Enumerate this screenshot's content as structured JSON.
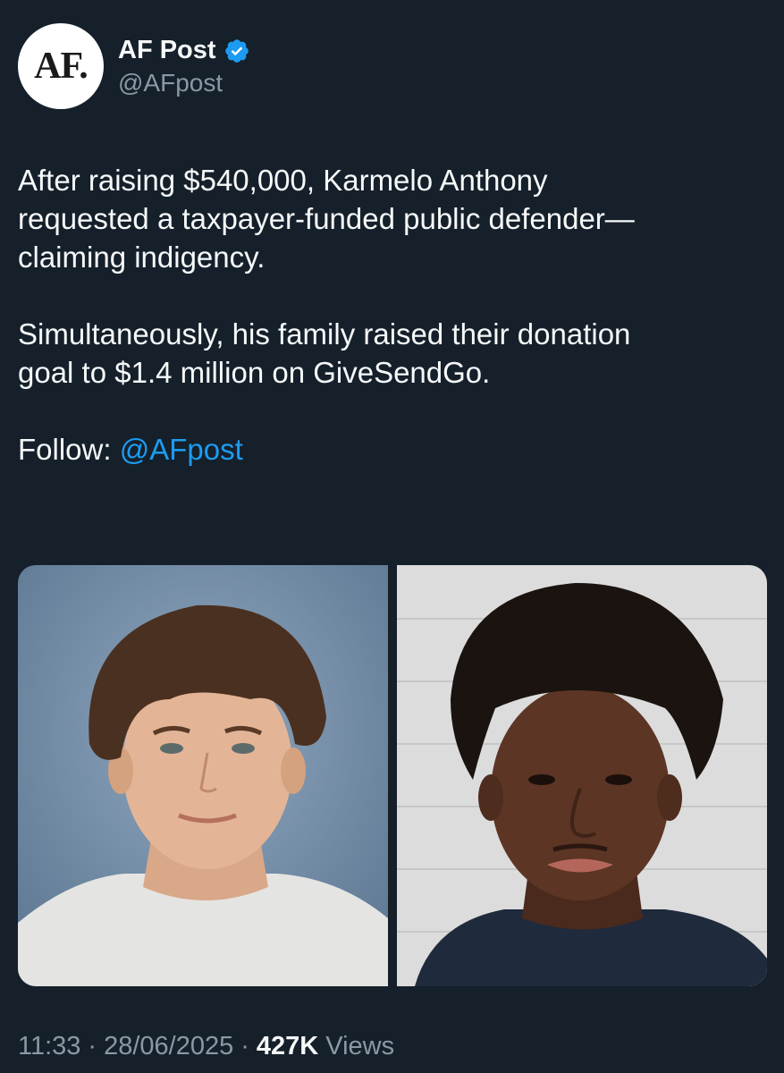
{
  "author": {
    "avatar_text": "AF.",
    "display_name": "AF Post",
    "handle": "@AFpost",
    "verified": true
  },
  "tweet": {
    "paragraph_1": "After raising $540,000, Karmelo Anthony\nrequested a taxpayer-funded public defender—\nclaiming indigency.",
    "paragraph_2": "Simultaneously, his family raised their donation\ngoal to $1.4 million on GiveSendGo.",
    "follow_label": "Follow: ",
    "follow_mention": "@AFpost"
  },
  "media": [
    {
      "name": "photo-left",
      "description_icon": "portrait-photo"
    },
    {
      "name": "photo-right",
      "description_icon": "portrait-photo"
    }
  ],
  "footer": {
    "time": "11:33",
    "date": "28/06/2025",
    "views_count": "427K",
    "views_label": "Views"
  },
  "colors": {
    "background": "#15202b",
    "accent": "#1d9bf0",
    "muted": "#8b98a5"
  }
}
